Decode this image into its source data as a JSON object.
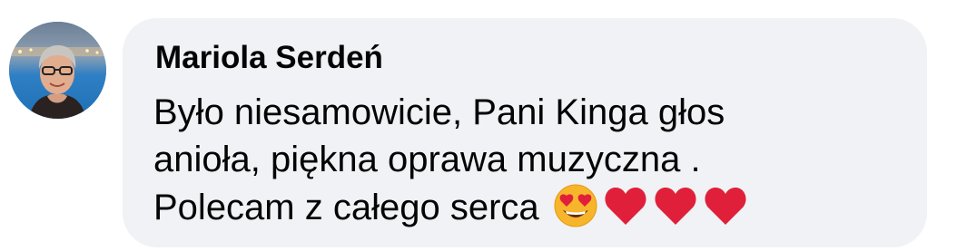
{
  "comment": {
    "author": "Mariola Serdeń",
    "lines": [
      "Było niesamowicie, Pani Kinga głos",
      "anioła, piękna oprawa muzyczna .",
      "Polecam z całego serca"
    ],
    "emojis": [
      "heart-eyes-emoji",
      "red-heart-emoji",
      "red-heart-emoji",
      "red-heart-emoji"
    ]
  },
  "colors": {
    "bubble_background": "#f0f2f5",
    "text": "#050505",
    "heart": "#e0203a",
    "emoji_face": "#f7b52b"
  }
}
